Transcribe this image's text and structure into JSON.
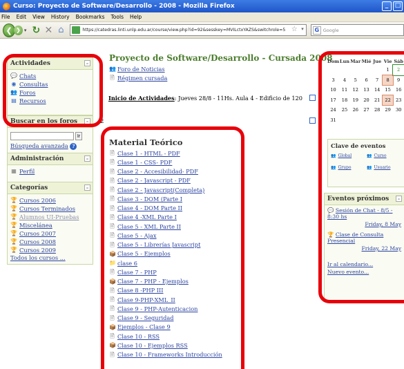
{
  "window": {
    "title": "Curso: Proyecto de Software/Desarrollo - 2008 - Mozilla Firefox"
  },
  "menu": [
    "File",
    "Edit",
    "View",
    "History",
    "Bookmarks",
    "Tools",
    "Help"
  ],
  "nav": {
    "url": "https://catedras.linti.unlp.edu.ar/course/view.php?id=92&sesskey=MVILctxYAZS&switchrole=5",
    "search_placeholder": "Google"
  },
  "blocks": {
    "actividades": {
      "title": "Actividades",
      "items": [
        {
          "label": "Chats",
          "icon": "chat-icon"
        },
        {
          "label": "Consultas",
          "icon": "consultation-icon"
        },
        {
          "label": "Foros",
          "icon": "forum-icon"
        },
        {
          "label": "Recursos",
          "icon": "resource-icon"
        }
      ]
    },
    "buscar": {
      "title": "Buscar en los foros",
      "button": "Ir",
      "advanced": "Búsqueda avanzada"
    },
    "admin": {
      "title": "Administración",
      "items": [
        {
          "label": "Perfil",
          "icon": "profile-icon"
        }
      ]
    },
    "categorias": {
      "title": "Categorías",
      "items": [
        "Cursos 2006",
        "Cursos Terminados",
        "Alumnos UI-Pruebas",
        "Miscelánea",
        "Cursos 2007",
        "Cursos 2008",
        "Cursos 2009"
      ],
      "all": "Todos los cursos ..."
    }
  },
  "course": {
    "title": "Proyecto de Software/Desarrollo - Cursada 2008",
    "top_links": [
      "Foro de Noticias",
      "Régimen cursada"
    ],
    "section1": {
      "num": "1",
      "label": "Inicio de Actividades",
      "text": ": Jueves 28/8 - 11Hs. Aula 4 - Edificio de 120"
    },
    "section2": {
      "num": "2",
      "title": "Material Teórico",
      "items": [
        "Clase 1 - HTML - PDF",
        "Clase 1 - CSS- PDF",
        "Clase 2 - Accesibilidad- PDF",
        "Clase 2 - Javascript - PDF",
        "Clase 2 - Javascript(Completa)",
        "Clase 3 - DOM (Parte I",
        "Clase 4 - DOM Parte II",
        "Clase 4 -XML Parte I",
        "Clase 5 - XML Parte II",
        "Clase 5 - Ajax",
        "Clase 5 - Librerías Javascript",
        "Clase 5 - Ejemplos",
        "clase 6",
        "Clase 7 - PHP",
        "Clase 7 - PHP - Ejemplos",
        "Clase 8 -PHP III",
        "Clase 9-PHP-XML_II",
        "Clase 9 - PHP-Autenticacion",
        "Clase 9 - Seguridad",
        "Ejemplos - Clase 9",
        "Clase 10 - RSS",
        "Clase 10 - Ejemplos RSS",
        "Clase 10 - Frameworks Introducción"
      ]
    }
  },
  "calendar": {
    "days": [
      "Dom",
      "Lun",
      "Mar",
      "Mié",
      "Jue",
      "Vie",
      "Sáb"
    ],
    "weeks": [
      [
        "",
        "",
        "",
        "",
        "",
        "1",
        "2"
      ],
      [
        "3",
        "4",
        "5",
        "6",
        "7",
        "8",
        "9"
      ],
      [
        "10",
        "11",
        "12",
        "13",
        "14",
        "15",
        "16"
      ],
      [
        "17",
        "18",
        "19",
        "20",
        "21",
        "22",
        "23"
      ],
      [
        "24",
        "25",
        "26",
        "27",
        "28",
        "29",
        "30"
      ],
      [
        "31",
        "",
        "",
        "",
        "",
        "",
        ""
      ]
    ],
    "today": "2",
    "event_days": [
      "8",
      "22"
    ]
  },
  "clave": {
    "title": "Clave de eventos",
    "keys": [
      "Global",
      "Curso",
      "Grupo",
      "Usuario"
    ]
  },
  "eventos": {
    "title": "Eventos próximos",
    "items": [
      {
        "label": "Sesión de Chat - 8/5 - 8:30 hs",
        "date": "Friday, 8 May"
      },
      {
        "label": "Clase de Consulta Presencial",
        "date": "Friday, 22 May"
      }
    ],
    "calendar_link": "Ir al calendario...",
    "new_event": "Nuevo evento..."
  },
  "colors": {
    "highlight": "#e8000b",
    "course_title": "#4b7d2d",
    "link": "#2b44a0"
  }
}
